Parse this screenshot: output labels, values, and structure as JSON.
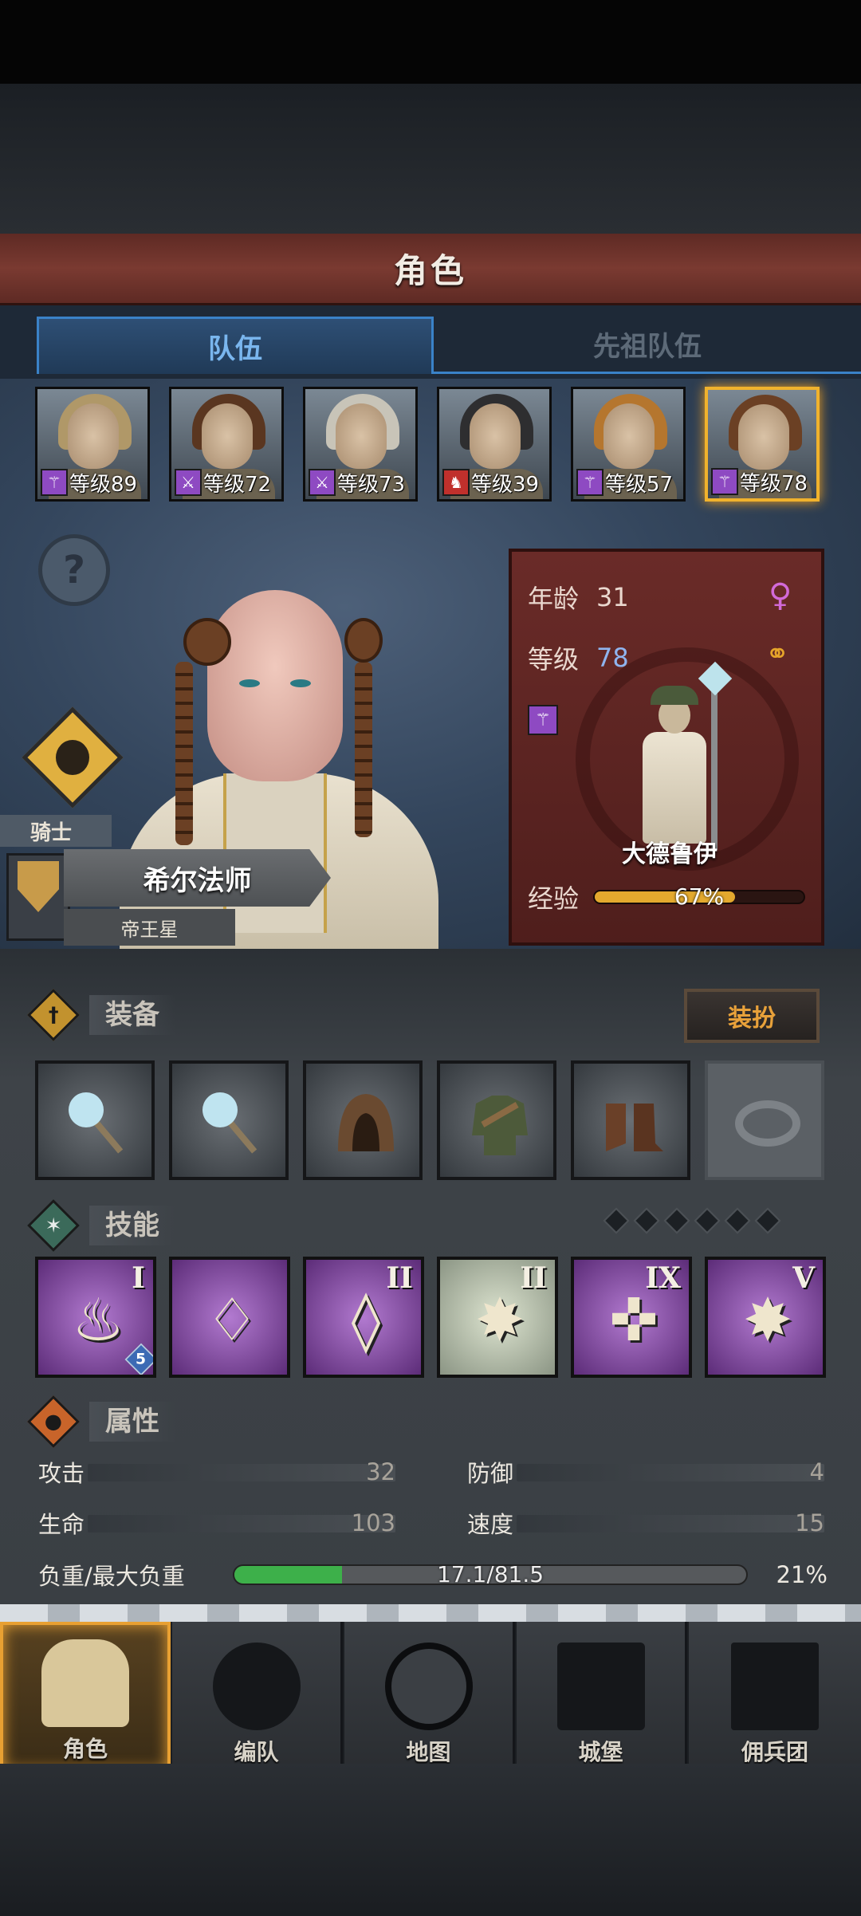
{
  "header": {
    "title": "角色"
  },
  "tabs": [
    {
      "label": "队伍",
      "active": true
    },
    {
      "label": "先祖队伍",
      "active": false
    }
  ],
  "party": [
    {
      "level_text": "等级89",
      "class_icon": "staff-icon",
      "hair": "#b09868"
    },
    {
      "level_text": "等级72",
      "class_icon": "sword-icon",
      "hair": "#5a3620"
    },
    {
      "level_text": "等级73",
      "class_icon": "sword-icon",
      "hair": "#c8c4b8"
    },
    {
      "level_text": "等级39",
      "class_icon": "beast-icon",
      "hair": "#2e2e30"
    },
    {
      "level_text": "等级57",
      "class_icon": "staff-icon",
      "hair": "#b5762e"
    },
    {
      "level_text": "等级78",
      "class_icon": "staff-icon",
      "hair": "#6b4024",
      "selected": true
    }
  ],
  "character": {
    "class_label": "骑士",
    "name": "希尔法师",
    "subtitle": "帝王星"
  },
  "info": {
    "age_label": "年龄",
    "age_value": "31",
    "level_label": "等级",
    "level_value": "78",
    "class_name": "大德鲁伊",
    "exp_label": "经验",
    "exp_text": "67%",
    "exp_fraction": 0.67
  },
  "equipment": {
    "title": "装备",
    "dress_button": "装扮",
    "slots": [
      "staff-item",
      "staff-item",
      "hood-item",
      "armor-item",
      "boots-item",
      "ring-empty-slot"
    ]
  },
  "skills": {
    "title": "技能",
    "pip_count": 6,
    "items": [
      {
        "roman": "I",
        "color": "purple",
        "icon": "flame-icon",
        "badge": "5"
      },
      {
        "roman": "",
        "color": "purple",
        "icon": "tornado-icon",
        "badge": ""
      },
      {
        "roman": "II",
        "color": "purple",
        "icon": "crystal-hand-icon",
        "badge": ""
      },
      {
        "roman": "II",
        "color": "green",
        "icon": "burst-icon",
        "badge": ""
      },
      {
        "roman": "IX",
        "color": "purple",
        "icon": "cross-target-icon",
        "badge": ""
      },
      {
        "roman": "V",
        "color": "purple",
        "icon": "burst-icon",
        "badge": ""
      }
    ]
  },
  "attributes": {
    "title": "属性",
    "attack_label": "攻击",
    "attack_value": "32",
    "defense_label": "防御",
    "defense_value": "4",
    "life_label": "生命",
    "life_value": "103",
    "speed_label": "速度",
    "speed_value": "15",
    "weight_label": "负重/最大负重",
    "weight_text": "17.1/81.5",
    "weight_percent": "21%",
    "weight_fraction": 0.21
  },
  "nav": [
    {
      "label": "角色",
      "icon": "knight-icon",
      "active": true
    },
    {
      "label": "编队",
      "icon": "helmet-icon",
      "active": false
    },
    {
      "label": "地图",
      "icon": "compass-icon",
      "active": false
    },
    {
      "label": "城堡",
      "icon": "castle-icon",
      "active": false
    },
    {
      "label": "佣兵团",
      "icon": "banner-icon",
      "active": false
    }
  ],
  "colors": {
    "accent_gold": "#f0b22d",
    "tab_blue": "#3a82c8",
    "panel_red": "#6a2b28",
    "weight_green": "#3db04a"
  }
}
